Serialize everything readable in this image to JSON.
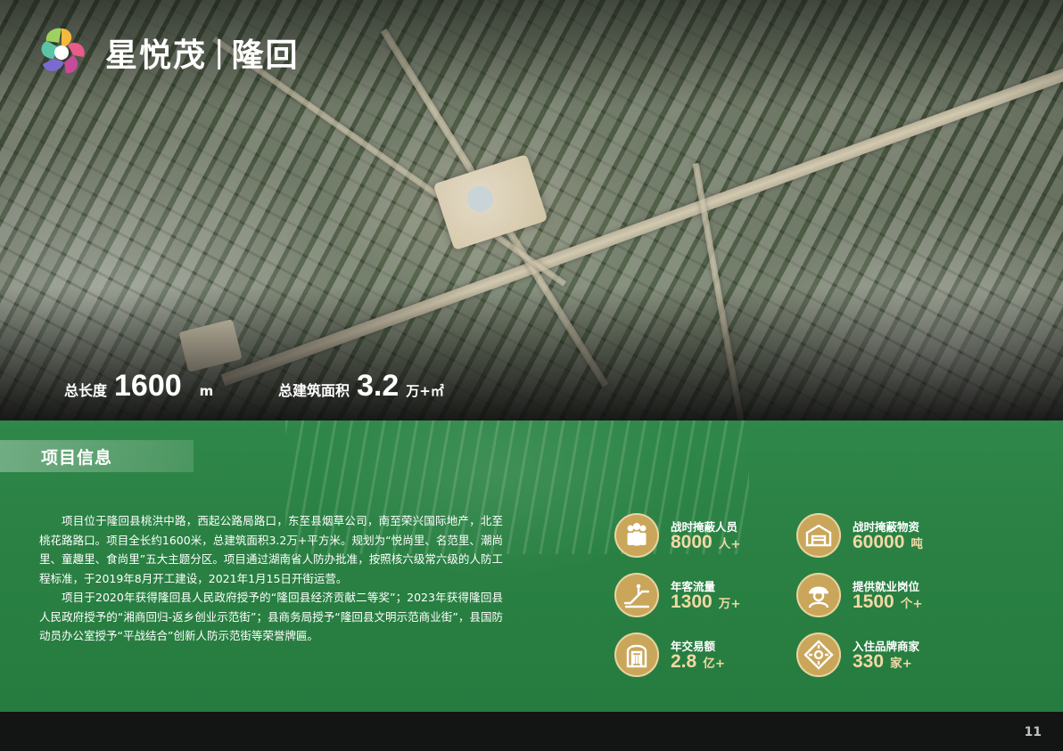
{
  "brand": {
    "name": "星悦茂",
    "separator": "|",
    "city": "隆回",
    "logo_icon": "star-petal-logo-icon"
  },
  "hero": {
    "length": {
      "label": "总长度",
      "value": "1600",
      "unit": "m"
    },
    "area": {
      "label": "总建筑面积",
      "value": "3.2",
      "unit": "万+㎡"
    }
  },
  "info": {
    "section_title": "项目信息",
    "paragraphs": [
      "项目位于隆回县桃洪中路，西起公路局路口，东至县烟草公司，南至荣兴国际地产，北至桃花路路口。项目全长约1600米，总建筑面积3.2万+平方米。规划为“悦尚里、名范里、潮尚里、童趣里、食尚里”五大主题分区。项目通过湖南省人防办批准，按照核六级常六级的人防工程标准，于2019年8月开工建设，2021年1月15日开街运营。",
      "项目于2020年获得隆回县人民政府授予的“隆回县经济贡献二等奖”；2023年获得隆回县人民政府授予的“湘商回归-返乡创业示范街”；县商务局授予“隆回县文明示范商业街”，县国防动员办公室授予“平战结合”创新人防示范街等荣誉牌匾。"
    ],
    "stats": [
      {
        "label": "战时掩蔽人员",
        "value": "8000",
        "unit": "人+",
        "icon": "people-shelter-icon"
      },
      {
        "label": "战时掩蔽物资",
        "value": "60000",
        "unit": "吨",
        "icon": "warehouse-icon"
      },
      {
        "label": "年客流量",
        "value": "1300",
        "unit": "万+",
        "icon": "escalator-icon"
      },
      {
        "label": "提供就业岗位",
        "value": "1500",
        "unit": "个+",
        "icon": "worker-icon"
      },
      {
        "label": "年交易额",
        "value": "2.8",
        "unit": "亿+",
        "icon": "shop-door-icon"
      },
      {
        "label": "入住品牌商家",
        "value": "330",
        "unit": "家+",
        "icon": "directions-icon"
      }
    ],
    "colors": {
      "green": "#2a8143",
      "gold": "#c9a65a",
      "gold_text": "#f1d9a5"
    }
  },
  "footer": {
    "page_number": "11"
  }
}
